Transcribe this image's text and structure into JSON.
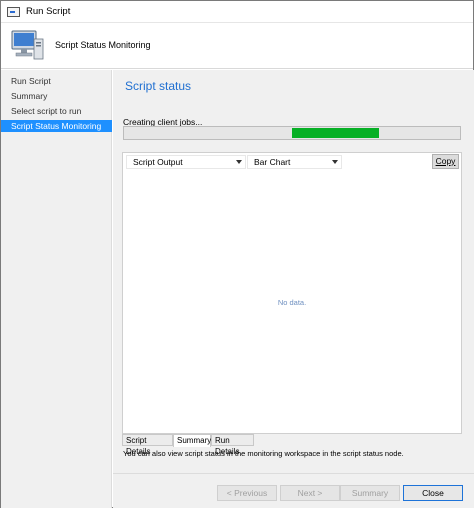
{
  "window": {
    "title": "Run Script"
  },
  "header": {
    "title": "Script Status Monitoring"
  },
  "sidebar": {
    "items": [
      {
        "label": "Run Script"
      },
      {
        "label": "Summary"
      },
      {
        "label": "Select script to run"
      },
      {
        "label": "Script Status Monitoring",
        "active": true
      }
    ]
  },
  "main": {
    "title": "Script status",
    "status_text": "Creating client jobs...",
    "output_select": "Script Output",
    "chart_select": "Bar Chart",
    "copy_label": "Copy",
    "empty_text": "No data.",
    "tabs": [
      {
        "label": "Script Details"
      },
      {
        "label": "Summary",
        "active": true
      },
      {
        "label": "Run Details"
      }
    ],
    "info_text": "You can also view script status in the monitoring workspace in the script status node."
  },
  "footer": {
    "previous_label": "< Previous",
    "next_label": "Next >",
    "summary_label": "Summary",
    "close_label": "Close"
  },
  "colors": {
    "accent": "#1e90ff",
    "progress": "#06b025",
    "title": "#1f6fd1"
  }
}
